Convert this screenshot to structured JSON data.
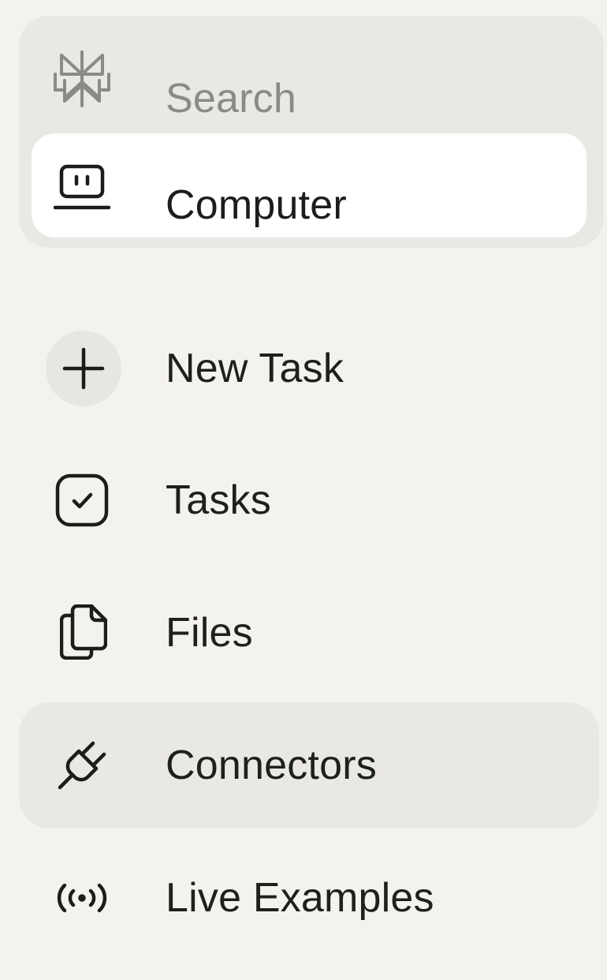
{
  "search": {
    "label": "Search",
    "icon": "perplexity-logo-icon"
  },
  "computer": {
    "label": "Computer",
    "icon": "laptop-icon"
  },
  "nav": [
    {
      "label": "New Task",
      "icon": "plus-icon"
    },
    {
      "label": "Tasks",
      "icon": "checkbox-icon"
    },
    {
      "label": "Files",
      "icon": "files-icon"
    },
    {
      "label": "Connectors",
      "icon": "plug-icon",
      "active": true
    },
    {
      "label": "Live Examples",
      "icon": "broadcast-icon"
    }
  ],
  "colors": {
    "background": "#f3f2ee",
    "group_background": "#e9e8e4",
    "selected_background": "#ffffff",
    "muted_text": "#8b8a86",
    "text": "#1f1f1c"
  }
}
